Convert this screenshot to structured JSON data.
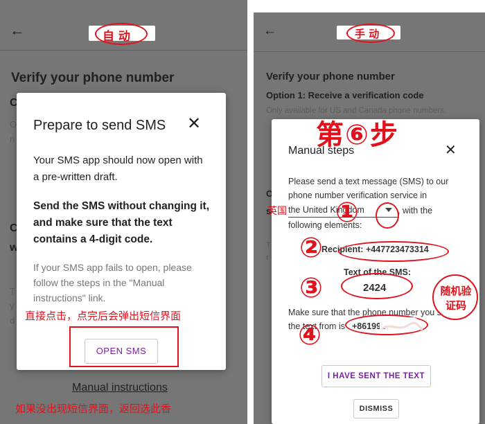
{
  "left": {
    "header_title": "自 动",
    "heading": "Verify your phone number",
    "dialog": {
      "title": "Prepare to send SMS",
      "close_glyph": "✕",
      "paragraph1": "Your SMS app should now open with a pre-written draft.",
      "paragraph2": "Send the SMS without changing it, and make sure that the text contains a 4-digit code.",
      "paragraph3": "If your SMS app fails to open, please follow the steps in the \"Manual instructions\" link.",
      "annotation": "直接点击，点完后会弹出短信界面",
      "open_sms_label": "OPEN SMS"
    },
    "manual_link": "Manual instructions",
    "bottom_annotation": "如果没出现短信界面，返回选此香"
  },
  "right": {
    "header_title": "手 动",
    "heading": "Verify your phone number",
    "option1": "Option 1: Receive a verification code",
    "option1_note": "Only available for US and Canada phone numbers.",
    "step_annotation": "第⑥步",
    "dialog": {
      "title": "Manual steps",
      "close_glyph": "✕",
      "line1": "Please send a text message (SMS) to our",
      "line2": "phone number verification service in",
      "country_select": "the United Kingdom",
      "line3_suffix": ", with the",
      "line4": "following elements:",
      "recipient_label": "Recipient:",
      "recipient_value": "+447723473314",
      "sms_text_label": "Text of the SMS:",
      "sms_code": "2424",
      "make_sure_line1": "Make sure that the phone number you send",
      "make_sure_line2": "the text from is",
      "from_number": "+861993",
      "sent_button": "I HAVE SENT THE TEXT",
      "dismiss_button": "DISMISS"
    },
    "annotations": {
      "country_cn": "英国",
      "random_code": "随机验证码",
      "num1": "①",
      "num2": "②",
      "num3": "③",
      "num4": "④"
    }
  },
  "colors": {
    "overlay": "#767676",
    "annotation_red": "#e0131d",
    "accent_purple": "#7b1fa2"
  }
}
